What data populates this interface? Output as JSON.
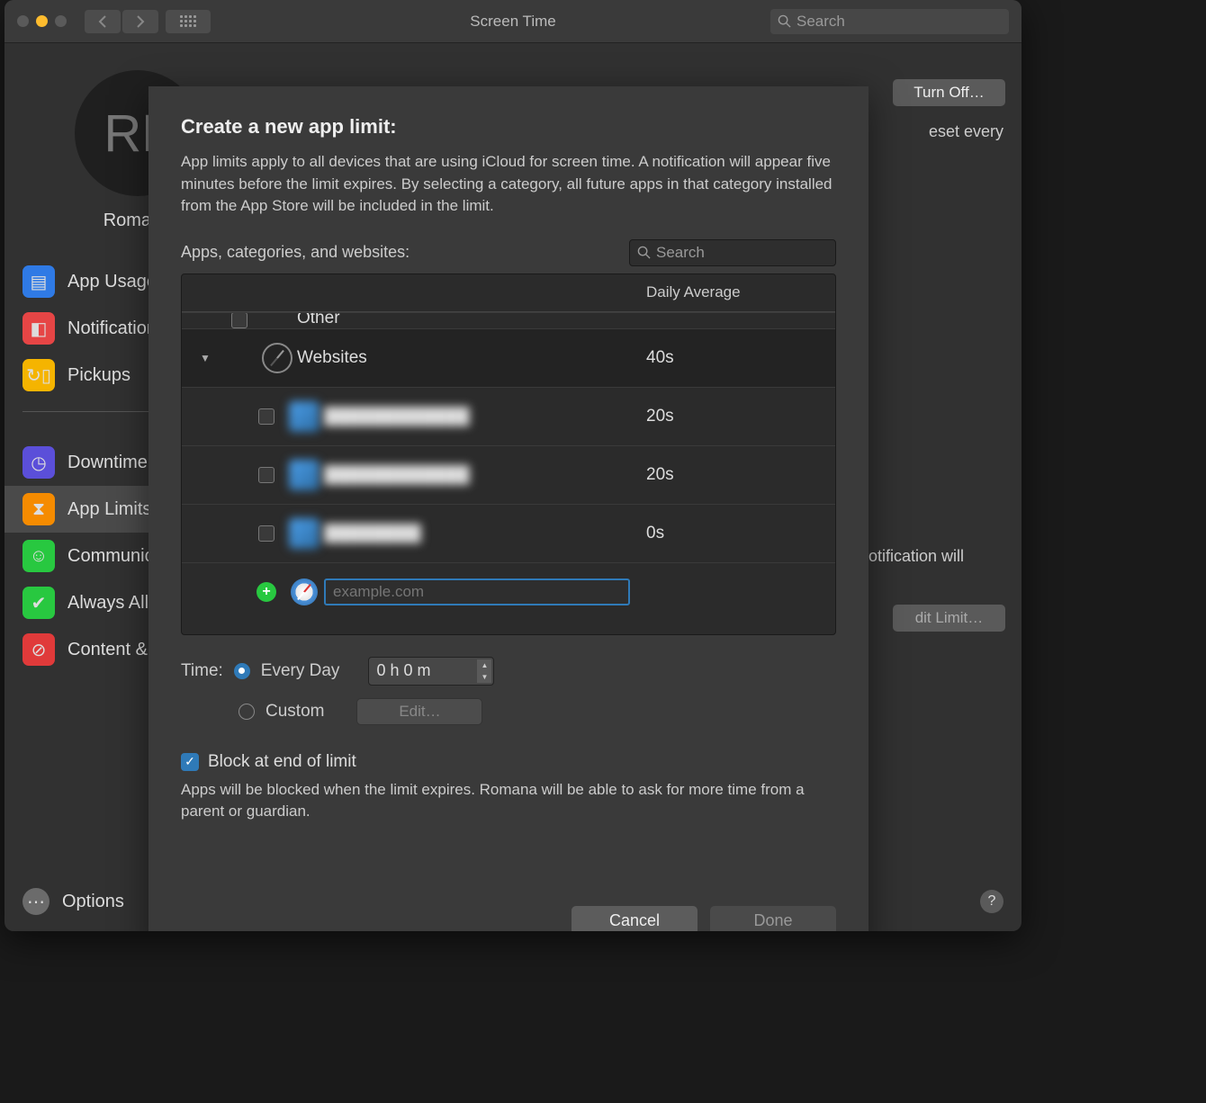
{
  "window": {
    "title": "Screen Time",
    "search_placeholder": "Search"
  },
  "sidebar": {
    "avatar_initials": "RL",
    "user_name": "Romana",
    "items": [
      {
        "label": "App Usage",
        "color": "#2f7ae5"
      },
      {
        "label": "Notifications",
        "color": "#e64545"
      },
      {
        "label": "Pickups",
        "color": "#f5b400"
      }
    ],
    "items2": [
      {
        "label": "Downtime",
        "color": "#5b4fd9"
      },
      {
        "label": "App Limits",
        "color": "#f58b00",
        "selected": true
      },
      {
        "label": "Communication",
        "color": "#28c840"
      },
      {
        "label": "Always Allowed",
        "color": "#28c840"
      },
      {
        "label": "Content & Privacy",
        "color": "#e03a3a"
      }
    ],
    "options_label": "Options"
  },
  "background_right": {
    "turn_off": "Turn Off…",
    "reset_text": "eset every",
    "notif_text": "otification will",
    "edit_limit": "dit Limit…"
  },
  "modal": {
    "title": "Create a new app limit:",
    "description": "App limits apply to all devices that are using iCloud for screen time. A notification will appear five minutes before the limit expires. By selecting a category, all future apps in that category installed from the App Store will be included in the limit.",
    "list_label": "Apps, categories, and websites:",
    "search_placeholder": "Search",
    "columns": {
      "name": "",
      "avg": "Daily Average"
    },
    "rows": {
      "cut_row": {
        "name": "Other",
        "value": ""
      },
      "category": {
        "name": "Websites",
        "value": "40s"
      },
      "children": [
        {
          "name": "████████████",
          "value": "20s"
        },
        {
          "name": "████████████",
          "value": "20s"
        },
        {
          "name": "████████",
          "value": "0s"
        }
      ],
      "add_placeholder": "example.com"
    },
    "time_label": "Time:",
    "every_day": "Every Day",
    "time_value": "0 h   0 m",
    "custom": "Custom",
    "edit": "Edit…",
    "block_label": "Block at end of limit",
    "block_desc": "Apps will be blocked when the limit expires. Romana will be able to ask for more time from a parent or guardian.",
    "cancel": "Cancel",
    "done": "Done"
  }
}
